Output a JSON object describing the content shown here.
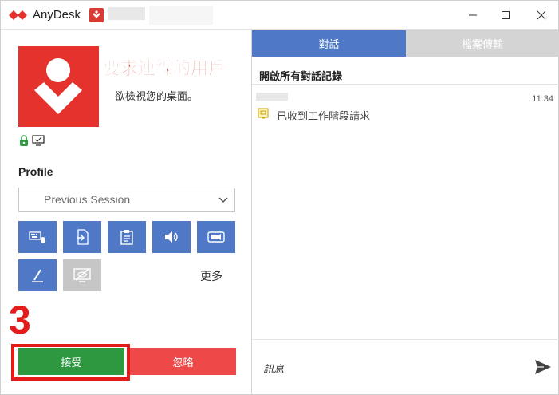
{
  "window": {
    "app_title": "AnyDesk",
    "minimize_icon": "minimize-icon",
    "maximize_icon": "maximize-icon",
    "close_icon": "close-icon"
  },
  "caller": {
    "label": "要求連線的用戶",
    "description": "欲檢視您的桌面。"
  },
  "profile": {
    "label": "Profile",
    "selected": "Previous Session"
  },
  "permissions": [
    {
      "icon": "keyboard-mouse-icon",
      "enabled": true
    },
    {
      "icon": "file-transfer-icon",
      "enabled": true
    },
    {
      "icon": "clipboard-icon",
      "enabled": true
    },
    {
      "icon": "sound-icon",
      "enabled": true
    },
    {
      "icon": "camera-icon",
      "enabled": true
    },
    {
      "icon": "draw-pen-icon",
      "enabled": true
    },
    {
      "icon": "privacy-mode-icon",
      "enabled": false
    }
  ],
  "more_label": "更多",
  "actions": {
    "accept": "接受",
    "dismiss": "忽略"
  },
  "annotation": {
    "step": "3",
    "color": "#e31b1b"
  },
  "tabs": {
    "chat": "對話",
    "file_transfer": "檔案傳輸"
  },
  "chat": {
    "open_log": "開啟所有對話記錄",
    "messages": [
      {
        "time": "11:34",
        "text": "已收到工作階段請求"
      }
    ],
    "input_placeholder": "訊息"
  },
  "colors": {
    "brand_red": "#e5322c",
    "accent_blue": "#4f79c6",
    "accept_green": "#2e9841",
    "dismiss_red": "#ee4848"
  }
}
